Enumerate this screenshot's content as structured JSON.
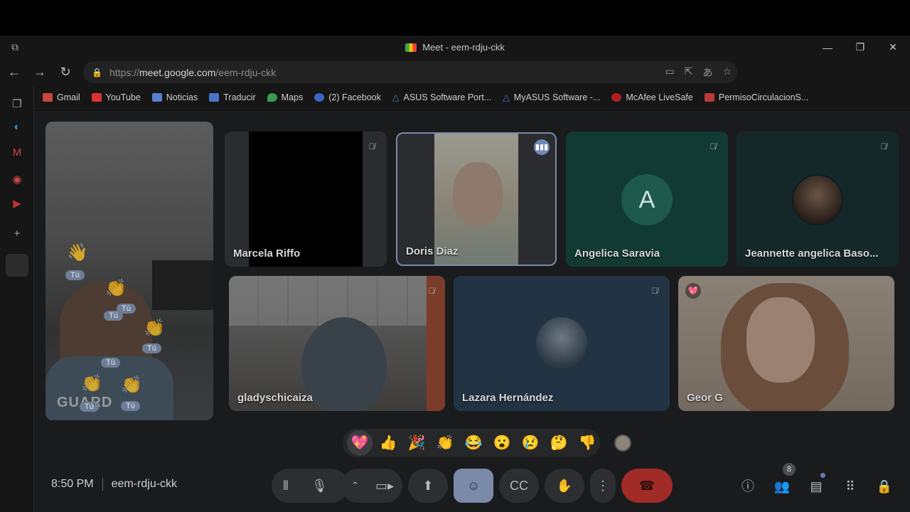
{
  "window": {
    "title": "Meet - eem-rdju-ckk"
  },
  "address": {
    "scheme": "https://",
    "host": "meet.google.com",
    "path": "/eem-rdju-ckk"
  },
  "bookmarks": [
    {
      "label": "Gmail",
      "color": "#c9463d"
    },
    {
      "label": "YouTube",
      "color": "#d33"
    },
    {
      "label": "Noticias",
      "color": "#5b7fd1"
    },
    {
      "label": "Traducir",
      "color": "#4a74c9"
    },
    {
      "label": "Maps",
      "color": "#3a9b55"
    },
    {
      "label": "(2) Facebook",
      "color": "#3b67c4"
    },
    {
      "label": "ASUS Software Port...",
      "color": "#3b57a8"
    },
    {
      "label": "MyASUS Software -...",
      "color": "#3b57a8"
    },
    {
      "label": "McAfee LiveSafe",
      "color": "#b32020"
    },
    {
      "label": "PermisoCirculacionS...",
      "color": "#b83a3a"
    }
  ],
  "self_tile": {
    "watermark": "GUARD",
    "chips": [
      "Tú",
      "Tú",
      "Tú",
      "Tú",
      "Tú",
      "Tú",
      "Tú"
    ]
  },
  "participants": [
    {
      "name": "Marcela Riffo"
    },
    {
      "name": "Doris Diaz"
    },
    {
      "name": "Angelica Saravia",
      "initial": "A"
    },
    {
      "name": "Jeannette angelica Baso..."
    },
    {
      "name": "gladyschicaiza"
    },
    {
      "name": "Lazara Hernández"
    },
    {
      "name": "Geor G"
    }
  ],
  "reactions": [
    "💖",
    "👍",
    "🎉",
    "👏",
    "😂",
    "😮",
    "😢",
    "🤔",
    "👎"
  ],
  "meeting": {
    "time": "8:50 PM",
    "code": "eem-rdju-ckk"
  },
  "people_count": "8"
}
